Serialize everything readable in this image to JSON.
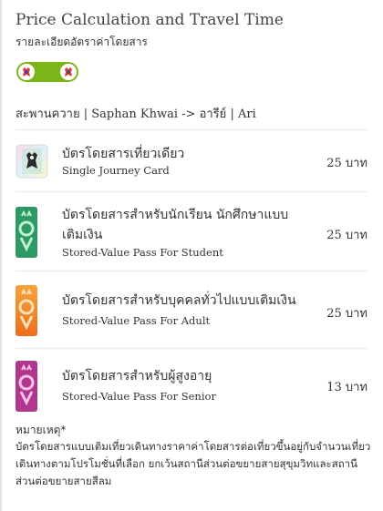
{
  "header": {
    "title": "Price Calculation and Travel Time",
    "subtitle": "รายละเอียดอัตราค่าโดยสาร"
  },
  "route": {
    "line_color": "#7cb518",
    "from_th": "สะพานควาย",
    "from_en": "Saphan Khwai",
    "arrow": "->",
    "to_th": "อารีย์",
    "to_en": "Ari",
    "sep": "|"
  },
  "fares": [
    {
      "name_th": "บัตรโดยสารเที่ยวเดียว",
      "name_en": "Single Journey Card",
      "price": "25",
      "unit": "บาท",
      "card_icon": "single-journey-card-icon"
    },
    {
      "name_th": "บัตรโดยสารสำหรับนักเรียน นักศึกษาแบบเติมเงิน",
      "name_en": "Stored-Value Pass For Student",
      "price": "25",
      "unit": "บาท",
      "card_icon": "student-card-icon",
      "card_label": "student",
      "card_color": "#2e9a63"
    },
    {
      "name_th": "บัตรโดยสารสำหรับบุคคลทั่วไปแบบเติมเงิน",
      "name_en": "Stored-Value Pass For Adult",
      "price": "25",
      "unit": "บาท",
      "card_icon": "adult-card-icon",
      "card_label": "adult",
      "card_color": "#f28c1e"
    },
    {
      "name_th": "บัตรโดยสารสำหรับผู้สูงอายุ",
      "name_en": "Stored-Value Pass For Senior",
      "price": "13",
      "unit": "บาท",
      "card_icon": "senior-card-icon",
      "card_label": "senior",
      "card_color": "#b0368e"
    }
  ],
  "note": {
    "label": "หมายเหตุ*",
    "text": "บัตรโดยสารแบบเติมเที่ยวเดินทางราคาค่าโดยสารต่อเที่ยวขึ้นอยู่กับจำนวนเที่ยวเดินทางตามโปรโมชั่นที่เลือก ยกเว้นสถานีส่วนต่อขยายสายสุขุมวิทและสถานีส่วนต่อขยายสายสีลม"
  }
}
